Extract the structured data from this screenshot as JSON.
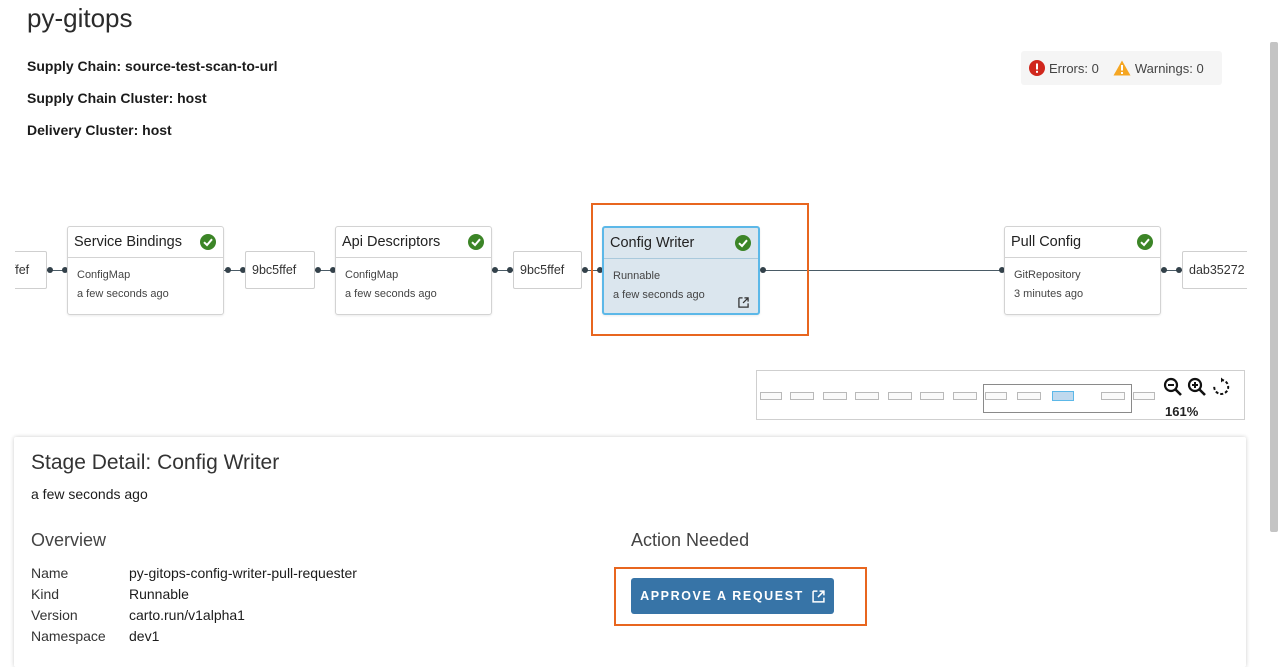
{
  "page": {
    "title": "py-gitops"
  },
  "meta": {
    "supply_chain": "Supply Chain: source-test-scan-to-url",
    "supply_chain_cluster": "Supply Chain Cluster: host",
    "delivery_cluster": "Delivery Cluster: host"
  },
  "status": {
    "errors": "Errors: 0",
    "warnings": "Warnings: 0"
  },
  "graph": {
    "resources": [
      "ffef",
      "9bc5ffef",
      "9bc5ffef",
      "dab35272"
    ],
    "stages": [
      {
        "name": "Service Bindings",
        "kind": "ConfigMap",
        "time": "a few seconds ago"
      },
      {
        "name": "Api Descriptors",
        "kind": "ConfigMap",
        "time": "a few seconds ago"
      },
      {
        "name": "Config Writer",
        "kind": "Runnable",
        "time": "a few seconds ago"
      },
      {
        "name": "Pull Config",
        "kind": "GitRepository",
        "time": "3 minutes ago"
      }
    ]
  },
  "zoom": {
    "level": "161%"
  },
  "detail": {
    "title": "Stage Detail: Config Writer",
    "time": "a few seconds ago",
    "overview_heading": "Overview",
    "action_heading": "Action Needed",
    "fields": [
      {
        "key": "Name",
        "value": "py-gitops-config-writer-pull-requester"
      },
      {
        "key": "Kind",
        "value": "Runnable"
      },
      {
        "key": "Version",
        "value": "carto.run/v1alpha1"
      },
      {
        "key": "Namespace",
        "value": "dev1"
      }
    ],
    "approve_button": "APPROVE A REQUEST"
  },
  "colors": {
    "accent": "#3774a7",
    "highlight": "#e8661f",
    "success": "#3c8527",
    "error": "#d0271d",
    "warning": "#f5a623"
  }
}
